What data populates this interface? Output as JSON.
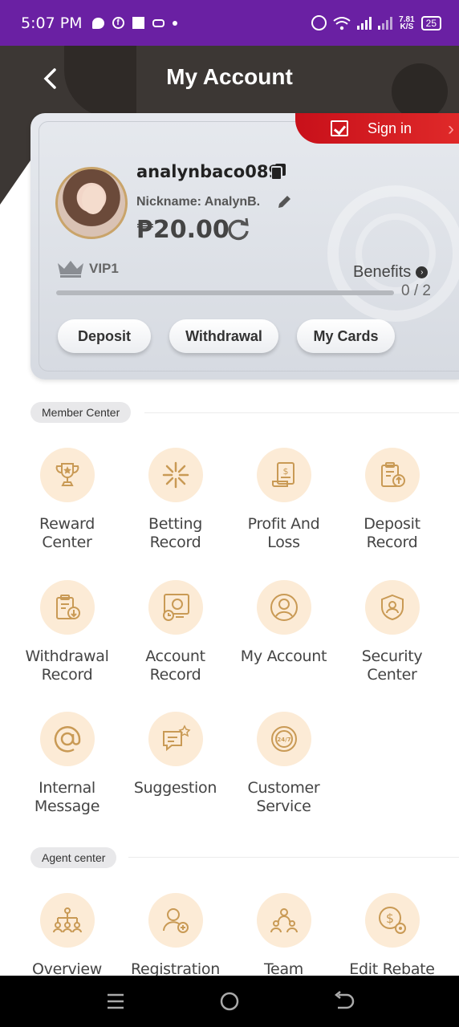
{
  "status_bar": {
    "time": "5:07 PM",
    "speed_value": "7.81",
    "speed_unit": "K/S",
    "battery": "25"
  },
  "header": {
    "title": "My Account"
  },
  "account": {
    "sign_in_label": "Sign in",
    "username": "analynbaco089",
    "nickname": "Nickname: AnalynB.",
    "balance": "₱20.00",
    "vip_level": "VIP1",
    "benefits_label": "Benefits",
    "progress_text": "0 / 2",
    "progress_fraction": 0,
    "buttons": {
      "deposit": "Deposit",
      "withdrawal": "Withdrawal",
      "my_cards": "My Cards"
    }
  },
  "member_center": {
    "label": "Member Center",
    "items": [
      {
        "label": "Reward Center",
        "icon": "trophy-icon"
      },
      {
        "label": "Betting Record",
        "icon": "star-burst-icon"
      },
      {
        "label": "Profit And Loss",
        "icon": "receipt-icon"
      },
      {
        "label": "Deposit Record",
        "icon": "clipboard-upload-icon"
      },
      {
        "label": "Withdrawal Record",
        "icon": "clipboard-download-icon"
      },
      {
        "label": "Account Record",
        "icon": "monitor-clock-icon"
      },
      {
        "label": "My Account",
        "icon": "user-circle-icon"
      },
      {
        "label": "Security Center",
        "icon": "shield-user-icon"
      },
      {
        "label": "Internal Message",
        "icon": "at-sign-icon"
      },
      {
        "label": "Suggestion",
        "icon": "chat-star-icon"
      },
      {
        "label": "Customer Service",
        "icon": "support-24-7-icon"
      }
    ]
  },
  "agent_center": {
    "label": "Agent center",
    "items": [
      {
        "label": "Overview",
        "icon": "org-chart-icon"
      },
      {
        "label": "Registration",
        "icon": "user-add-icon"
      },
      {
        "label": "Team",
        "icon": "team-icon"
      },
      {
        "label": "Edit Rebate",
        "icon": "money-gear-icon"
      }
    ]
  },
  "colors": {
    "status_bar": "#6a20a3",
    "header": "#3c3734",
    "sign_in": "#d6141f",
    "accent_gold": "#d4a456",
    "icon_bg": "#fcebd6"
  }
}
